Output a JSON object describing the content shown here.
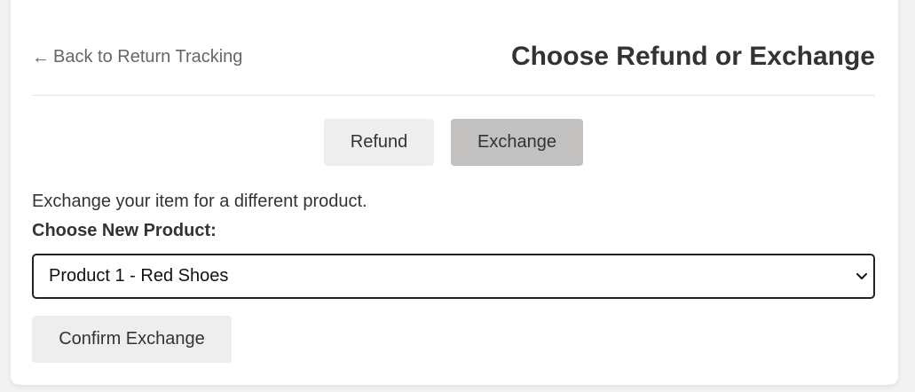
{
  "header": {
    "back_arrow": "←",
    "back_label": "Back to Return Tracking",
    "title": "Choose Refund or Exchange"
  },
  "options": {
    "refund_label": "Refund",
    "exchange_label": "Exchange",
    "selected": "Exchange"
  },
  "exchange": {
    "description": "Exchange your item for a different product.",
    "product_label": "Choose New Product:",
    "selected_product": "Product 1 - Red Shoes",
    "confirm_label": "Confirm Exchange"
  },
  "icons": {
    "back": "left-arrow-icon",
    "select": "chevron-down-icon"
  },
  "colors": {
    "active_toggle": "#c3c0c0",
    "inactive_toggle": "#eeeeee",
    "text": "#333333",
    "link": "#666666"
  }
}
